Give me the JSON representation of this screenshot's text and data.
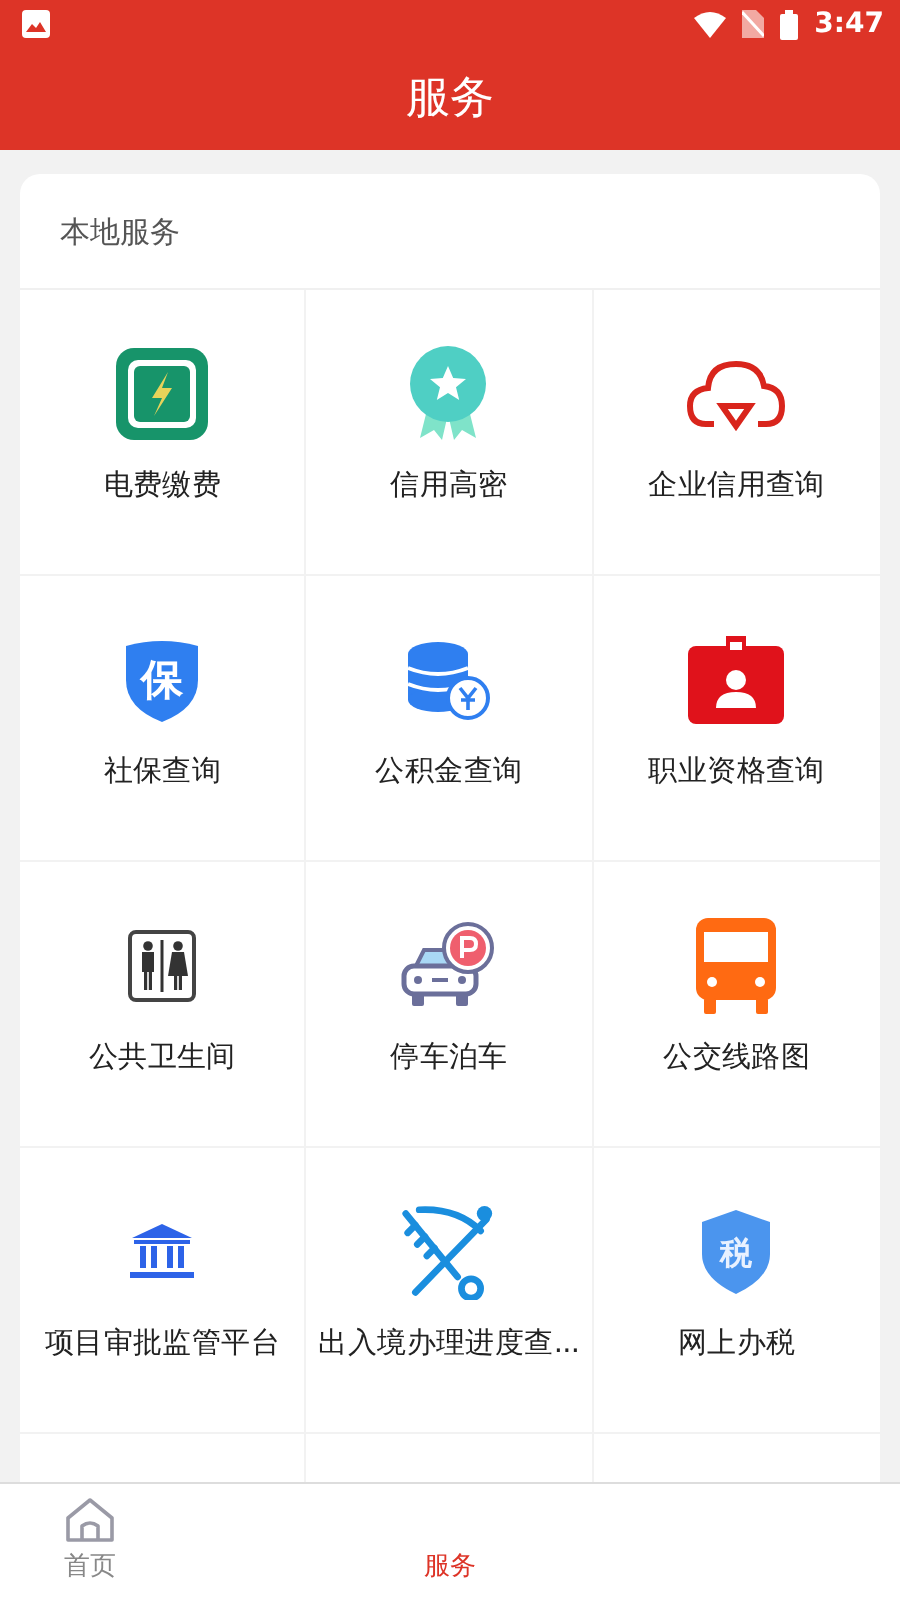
{
  "status_bar": {
    "time": "3:47"
  },
  "header": {
    "title": "服务"
  },
  "section": {
    "title": "本地服务",
    "items": [
      {
        "label": "电费缴费"
      },
      {
        "label": "信用高密"
      },
      {
        "label": "企业信用查询"
      },
      {
        "label": "社保查询",
        "icon_text": "保"
      },
      {
        "label": "公积金查询"
      },
      {
        "label": "职业资格查询"
      },
      {
        "label": "公共卫生间"
      },
      {
        "label": "停车泊车"
      },
      {
        "label": "公交线路图"
      },
      {
        "label": "项目审批监管平台"
      },
      {
        "label": "出入境办理进度查..."
      },
      {
        "label": "网上办税",
        "icon_text": "税"
      }
    ]
  },
  "bottom_nav": [
    {
      "label": "首页",
      "selected": false
    },
    {
      "label": "服务",
      "selected": true
    }
  ]
}
